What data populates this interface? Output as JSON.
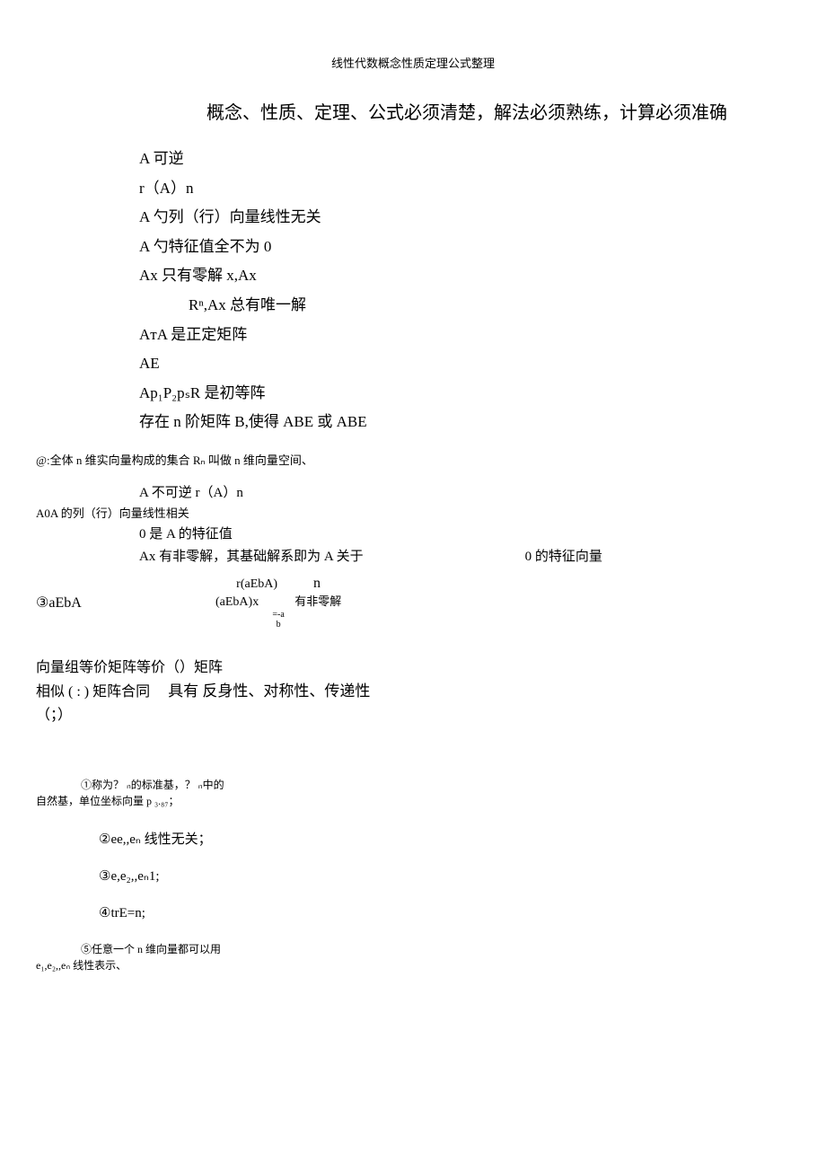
{
  "header": "线性代数概念性质定理公式整理",
  "main_statement": "概念、性质、定理、公式必须清楚，解法必须熟练，计算必须准确",
  "invertible_list": {
    "i1": "A 可逆",
    "i2": "r（A）n",
    "i3": "A 勺列（行）向量线性无关",
    "i4": "A 勺特征值全不为 0",
    "i5": "Ax 只有零解 x,Ax",
    "i5b": "Rⁿ,Ax 总有唯一解",
    "i6": "AᴛA 是正定矩阵",
    "i7": "AE",
    "i8": "Ap₁P₂pₛR 是初等阵",
    "i9": "存在 n 阶矩阵 B,使得 ABE 或 ABE"
  },
  "note1": "@:全体 n 维实向量构成的集合 Rₙ 叫做 n 维向量空间、",
  "noninv": {
    "l1": "A 不可逆 r（A）n",
    "l2": "A0A 的列（行）向量线性相关",
    "l3": "0 是 A 的特征值",
    "l4a": "Ax 有非零解，其基础解系即为 A 关于",
    "l4b": "0 的特征向量"
  },
  "frac": {
    "left": "③aEbA",
    "top": "r(aEbA)",
    "mid": "(aEbA)x",
    "tiny1": "=-a",
    "tiny2": "b",
    "n": "n",
    "right": "有非零解"
  },
  "equiv": {
    "l1": "向量组等价矩阵等价（）矩阵",
    "l2_left": "相似 ( : ) 矩阵合同",
    "l3": "（；）",
    "l2_right": "具有 反身性、对称性、传递性"
  },
  "std": {
    "l1a": "①称为？ ₙ的标准基，？ ₙ中的",
    "l1b": "自然基，单位坐标向量 p ₃.₈₇；",
    "l2": "②ee,,eₙ 线性无关；",
    "l3": "③e,e₂,,eₙ1;",
    "l4": "④trE=n;",
    "l5a": "⑤任意一个 n 维向量都可以用",
    "l5b": "e₁,e₂,,eₙ 线性表示、"
  }
}
